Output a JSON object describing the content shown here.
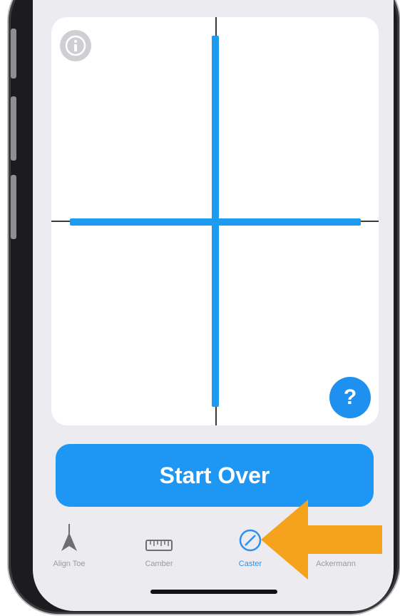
{
  "card": {
    "info_icon": "info-icon",
    "help_label": "?"
  },
  "start_over_label": "Start Over",
  "tabs": [
    {
      "label": "Align Toe",
      "icon": "align-toe-icon",
      "active": false
    },
    {
      "label": "Camber",
      "icon": "ruler-icon",
      "active": false
    },
    {
      "label": "Caster",
      "icon": "caster-icon",
      "active": true
    },
    {
      "label": "Ackermann",
      "icon": "ackermann-icon",
      "active": false
    }
  ],
  "colors": {
    "accent": "#1e96f3",
    "annotation_arrow": "#f5a21c"
  }
}
